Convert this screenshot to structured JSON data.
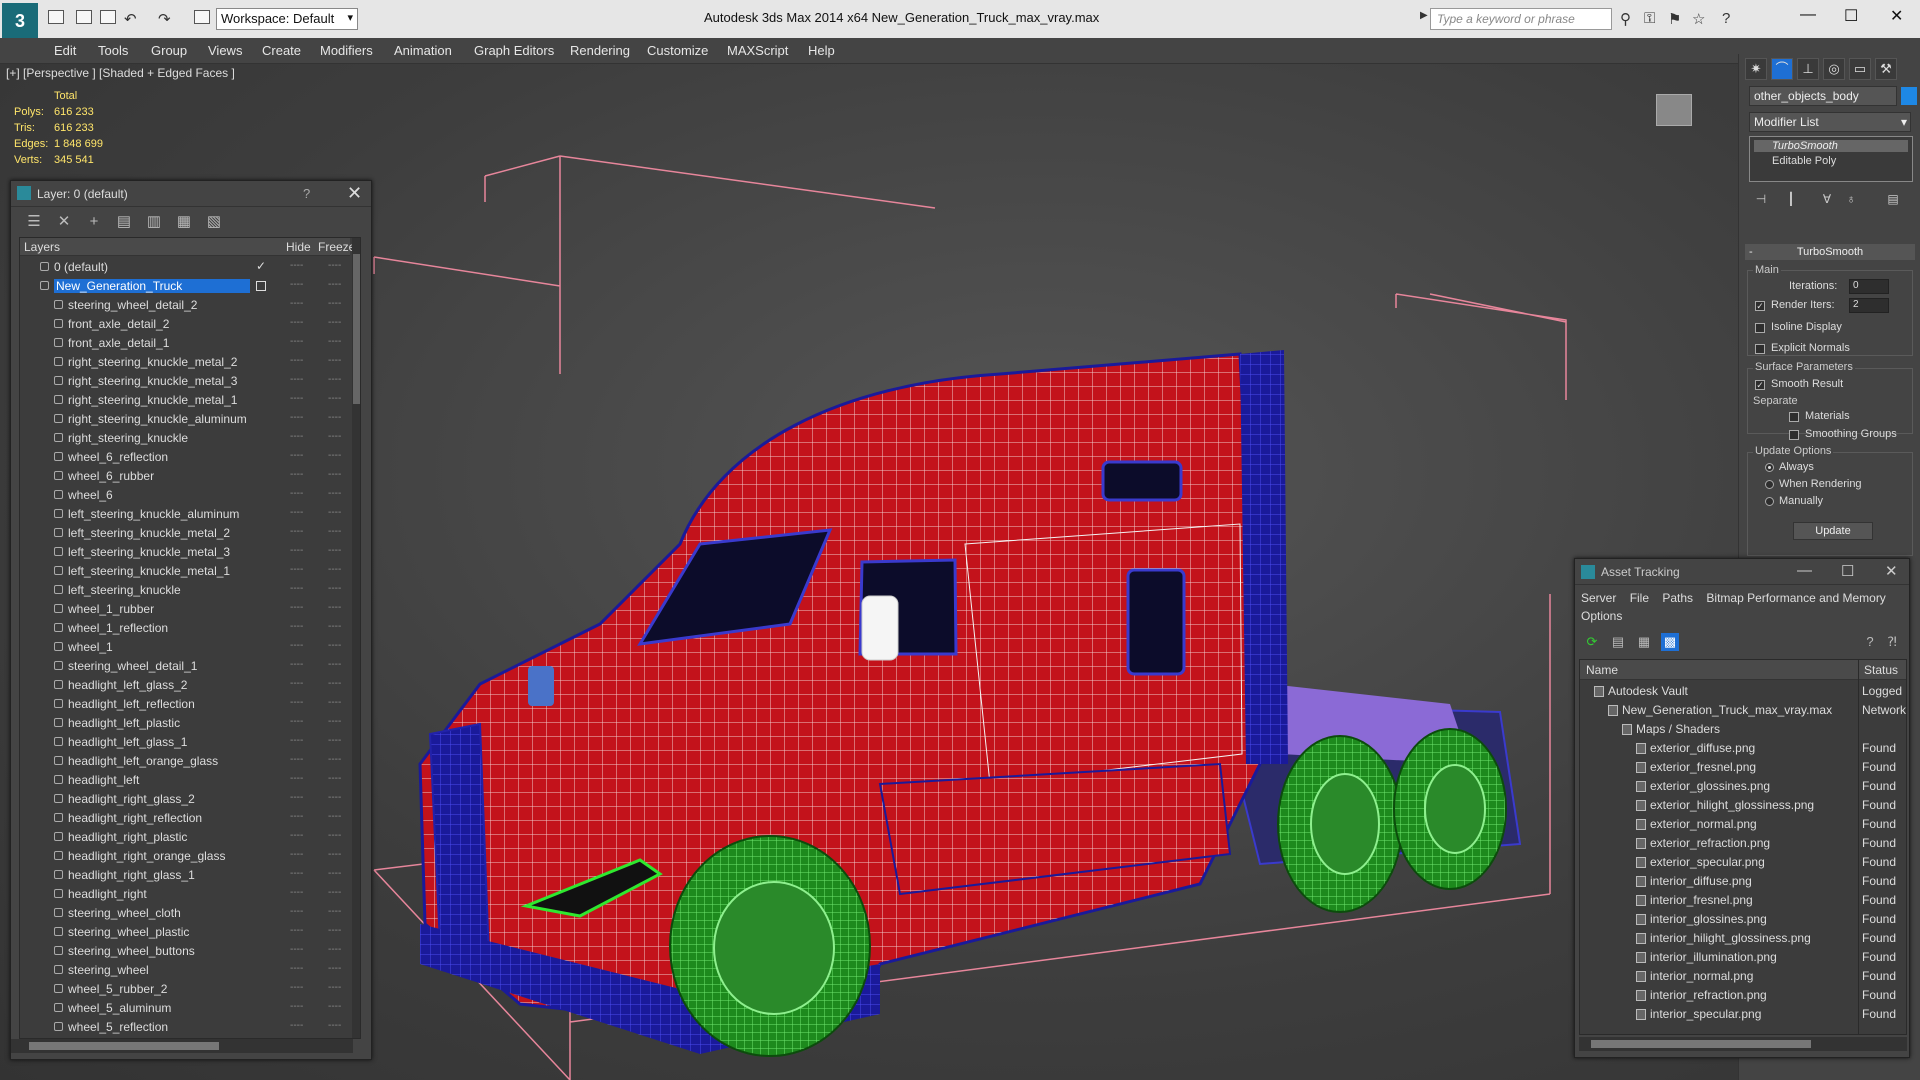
{
  "titlebar": {
    "workspace": "Workspace: Default",
    "app_title": "Autodesk 3ds Max  2014 x64       New_Generation_Truck_max_vray.max",
    "search_placeholder": "Type a keyword or phrase"
  },
  "menu": [
    "Edit",
    "Tools",
    "Group",
    "Views",
    "Create",
    "Modifiers",
    "Animation",
    "Graph Editors",
    "Rendering",
    "Customize",
    "MAXScript",
    "Help"
  ],
  "viewport": {
    "label": "[+] [Perspective ] [Shaded + Edged Faces ]",
    "stats": {
      "header": "Total",
      "polys_label": "Polys:",
      "polys": "616 233",
      "tris_label": "Tris:",
      "tris": "616 233",
      "edges_label": "Edges:",
      "edges": "1 848 699",
      "verts_label": "Verts:",
      "verts": "345 541"
    }
  },
  "layer_dialog": {
    "title": "Layer: 0 (default)",
    "help": "?",
    "col_layers": "Layers",
    "col_hide": "Hide",
    "col_freeze": "Freeze",
    "layers": [
      {
        "name": "0 (default)",
        "level": 0
      },
      {
        "name": "New_Generation_Truck",
        "level": 0,
        "selected": true
      },
      {
        "name": "steering_wheel_detail_2",
        "level": 1
      },
      {
        "name": "front_axle_detail_2",
        "level": 1
      },
      {
        "name": "front_axle_detail_1",
        "level": 1
      },
      {
        "name": "right_steering_knuckle_metal_2",
        "level": 1
      },
      {
        "name": "right_steering_knuckle_metal_3",
        "level": 1
      },
      {
        "name": "right_steering_knuckle_metal_1",
        "level": 1
      },
      {
        "name": "right_steering_knuckle_aluminum",
        "level": 1
      },
      {
        "name": "right_steering_knuckle",
        "level": 1
      },
      {
        "name": "wheel_6_reflection",
        "level": 1
      },
      {
        "name": "wheel_6_rubber",
        "level": 1
      },
      {
        "name": "wheel_6",
        "level": 1
      },
      {
        "name": "left_steering_knuckle_aluminum",
        "level": 1
      },
      {
        "name": "left_steering_knuckle_metal_2",
        "level": 1
      },
      {
        "name": "left_steering_knuckle_metal_3",
        "level": 1
      },
      {
        "name": "left_steering_knuckle_metal_1",
        "level": 1
      },
      {
        "name": "left_steering_knuckle",
        "level": 1
      },
      {
        "name": "wheel_1_rubber",
        "level": 1
      },
      {
        "name": "wheel_1_reflection",
        "level": 1
      },
      {
        "name": "wheel_1",
        "level": 1
      },
      {
        "name": "steering_wheel_detail_1",
        "level": 1
      },
      {
        "name": "headlight_left_glass_2",
        "level": 1
      },
      {
        "name": "headlight_left_reflection",
        "level": 1
      },
      {
        "name": "headlight_left_plastic",
        "level": 1
      },
      {
        "name": "headlight_left_glass_1",
        "level": 1
      },
      {
        "name": "headlight_left_orange_glass",
        "level": 1
      },
      {
        "name": "headlight_left",
        "level": 1
      },
      {
        "name": "headlight_right_glass_2",
        "level": 1
      },
      {
        "name": "headlight_right_reflection",
        "level": 1
      },
      {
        "name": "headlight_right_plastic",
        "level": 1
      },
      {
        "name": "headlight_right_orange_glass",
        "level": 1
      },
      {
        "name": "headlight_right_glass_1",
        "level": 1
      },
      {
        "name": "headlight_right",
        "level": 1
      },
      {
        "name": "steering_wheel_cloth",
        "level": 1
      },
      {
        "name": "steering_wheel_plastic",
        "level": 1
      },
      {
        "name": "steering_wheel_buttons",
        "level": 1
      },
      {
        "name": "steering_wheel",
        "level": 1
      },
      {
        "name": "wheel_5_rubber_2",
        "level": 1
      },
      {
        "name": "wheel_5_aluminum",
        "level": 1
      },
      {
        "name": "wheel_5_reflection",
        "level": 1
      }
    ]
  },
  "command_panel": {
    "object_name": "other_objects_body",
    "object_color": "#1e88e5",
    "modifier_list": "Modifier List",
    "stack": [
      "TurboSmooth",
      "Editable Poly"
    ],
    "turbosmooth": {
      "title": "TurboSmooth",
      "main": "Main",
      "iterations_label": "Iterations:",
      "iterations": "0",
      "render_iters_label": "Render Iters:",
      "render_iters": "2",
      "isoline": "Isoline Display",
      "explicit_normals": "Explicit Normals",
      "surface_params": "Surface Parameters",
      "smooth_result": "Smooth Result",
      "separate": "Separate",
      "materials": "Materials",
      "smoothing_groups": "Smoothing Groups",
      "update_options": "Update Options",
      "always": "Always",
      "when_rendering": "When Rendering",
      "manually": "Manually",
      "update": "Update"
    }
  },
  "asset_tracking": {
    "title": "Asset Tracking",
    "menu": [
      "Server",
      "File",
      "Paths",
      "Bitmap Performance and Memory",
      "Options"
    ],
    "col_name": "Name",
    "col_status": "Status",
    "rows": [
      {
        "name": "Autodesk Vault",
        "status": "Logged C",
        "level": 0
      },
      {
        "name": "New_Generation_Truck_max_vray.max",
        "status": "Network",
        "level": 1
      },
      {
        "name": "Maps / Shaders",
        "status": "",
        "level": 2
      },
      {
        "name": "exterior_diffuse.png",
        "status": "Found",
        "level": 3
      },
      {
        "name": "exterior_fresnel.png",
        "status": "Found",
        "level": 3
      },
      {
        "name": "exterior_glossines.png",
        "status": "Found",
        "level": 3
      },
      {
        "name": "exterior_hilight_glossiness.png",
        "status": "Found",
        "level": 3
      },
      {
        "name": "exterior_normal.png",
        "status": "Found",
        "level": 3
      },
      {
        "name": "exterior_refraction.png",
        "status": "Found",
        "level": 3
      },
      {
        "name": "exterior_specular.png",
        "status": "Found",
        "level": 3
      },
      {
        "name": "interior_diffuse.png",
        "status": "Found",
        "level": 3
      },
      {
        "name": "interior_fresnel.png",
        "status": "Found",
        "level": 3
      },
      {
        "name": "interior_glossines.png",
        "status": "Found",
        "level": 3
      },
      {
        "name": "interior_hilight_glossiness.png",
        "status": "Found",
        "level": 3
      },
      {
        "name": "interior_illumination.png",
        "status": "Found",
        "level": 3
      },
      {
        "name": "interior_normal.png",
        "status": "Found",
        "level": 3
      },
      {
        "name": "interior_refraction.png",
        "status": "Found",
        "level": 3
      },
      {
        "name": "interior_specular.png",
        "status": "Found",
        "level": 3
      }
    ]
  }
}
